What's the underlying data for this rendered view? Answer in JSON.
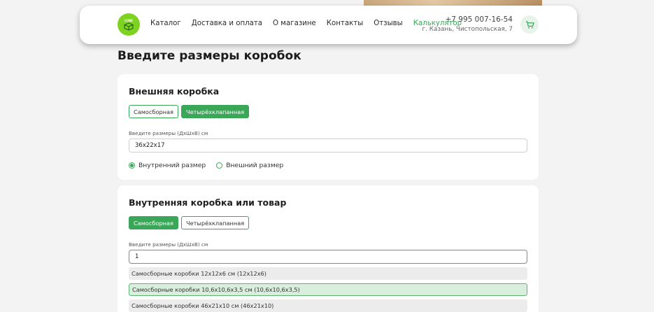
{
  "header": {
    "logo_text": "CUBE",
    "nav": [
      {
        "label": "Каталог",
        "active": false
      },
      {
        "label": "Доставка и оплата",
        "active": false
      },
      {
        "label": "О магазине",
        "active": false
      },
      {
        "label": "Контакты",
        "active": false
      },
      {
        "label": "Отзывы",
        "active": false
      },
      {
        "label": "Калькулятор",
        "active": true
      }
    ],
    "phone": "+7 995 007-16-54",
    "address": "г. Казань, Чистопольская, 7",
    "cart_icon": "cart-icon"
  },
  "page_title": "Введите размеры коробок",
  "outer_box": {
    "title": "Внешняя коробка",
    "types": [
      {
        "label": "Самосборная",
        "selected": false
      },
      {
        "label": "Четырёхклапанная",
        "selected": true
      }
    ],
    "dims_label": "Введите размеры (ДхШхВ) см",
    "dims_value": "36x22x17",
    "size_options": [
      {
        "label": "Внутренний размер",
        "checked": true
      },
      {
        "label": "Внешний размер",
        "checked": false
      }
    ]
  },
  "inner_box": {
    "title": "Внутренняя коробка или товар",
    "types": [
      {
        "label": "Самосборная",
        "selected": true
      },
      {
        "label": "Четырёхклапанная",
        "selected": false
      }
    ],
    "dims_label": "Введите размеры (ДхШхВ) см",
    "dims_value": "1",
    "suggestions": [
      {
        "label": "Самосборные коробки 12x12x6 см (12x12x6)",
        "highlighted": false
      },
      {
        "label": "Самосборные коробки 10,6x10,6x3,5 см (10,6x10,6x3,5)",
        "highlighted": true
      },
      {
        "label": "Самосборные коробки 46x21x10 см (46x21x10)",
        "highlighted": false
      }
    ]
  },
  "colors": {
    "accent": "#3aa657",
    "logo": "#7ed321",
    "background": "#f3f3f3"
  }
}
